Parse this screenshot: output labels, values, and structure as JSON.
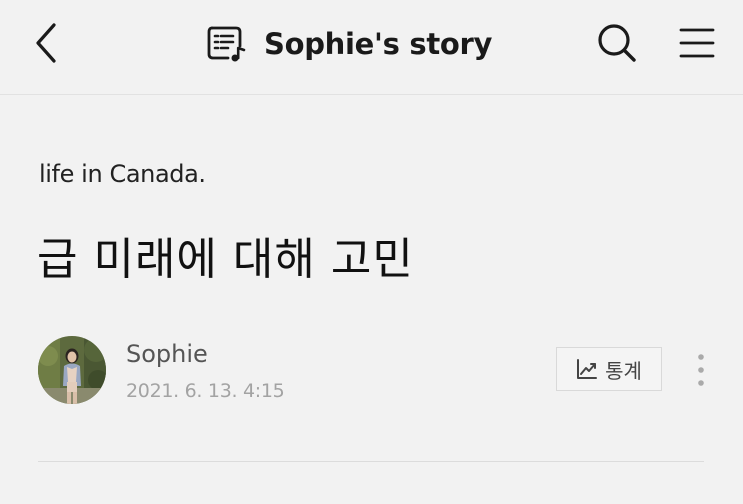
{
  "header": {
    "title": "Sophie's story",
    "back_icon": "chevron-left-icon",
    "title_icon": "post-list-icon",
    "search_icon": "search-icon",
    "menu_icon": "hamburger-menu-icon"
  },
  "post": {
    "category": "life in Canada.",
    "title": "급 미래에 대해 고민",
    "author": {
      "name": "Sophie",
      "avatar_icon": "profile-photo"
    },
    "date": "2021. 6. 13. 4:15",
    "stats_button": {
      "label": "통계",
      "icon": "trend-chart-icon"
    },
    "more_icon": "vertical-dots-icon"
  },
  "colors": {
    "background": "#f2f2f2",
    "text_primary": "#111111",
    "text_author": "#555555",
    "text_date": "#a3a3a3",
    "divider": "#dcdcdc"
  }
}
